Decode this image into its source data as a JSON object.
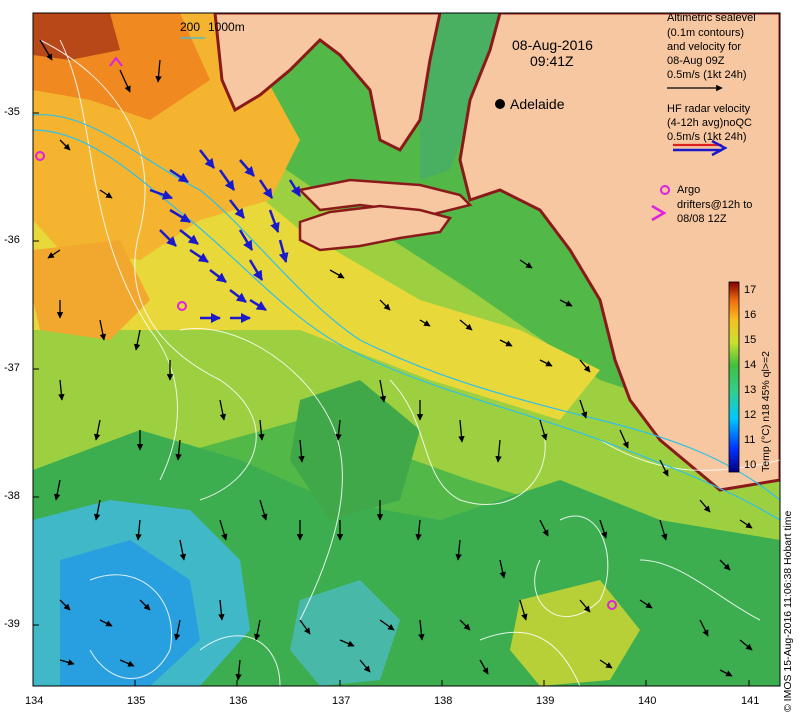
{
  "map": {
    "date_line": "08-Aug-2016",
    "time_line": "09:41Z",
    "city": "Adelaide",
    "depth_labels": [
      "200",
      "1000m"
    ],
    "lon_ticks": [
      "134",
      "135",
      "136",
      "137",
      "138",
      "139",
      "140",
      "141"
    ],
    "lat_ticks": [
      "-35",
      "-36",
      "-37",
      "-38",
      "-39"
    ]
  },
  "legend": {
    "altimetry": [
      "Altimetric sealevel",
      "(0.1m contours)",
      "and velocity for",
      "08-Aug 09Z",
      "0.5m/s (1kt 24h)"
    ],
    "hf_radar": [
      "HF radar velocity",
      "(4-12h avg)noQC",
      "0.5m/s (1kt 24h)"
    ],
    "argo": [
      "Argo",
      "drifters@12h to",
      "08/08 12Z"
    ]
  },
  "colorbar": {
    "title": "Temp (°C) n18 45% ql>=2",
    "ticks": [
      "17",
      "16",
      "15",
      "14",
      "13",
      "12",
      "11",
      "10"
    ]
  },
  "credit": "© IMOS 15-Aug-2016 11:06:38 Hobart time",
  "colors": {
    "land": "#f6c7a0",
    "coast": "#8a1a1a",
    "argo": "#e020e0",
    "radar": "#1a1acc",
    "altimetry_arrow": "#000000"
  }
}
